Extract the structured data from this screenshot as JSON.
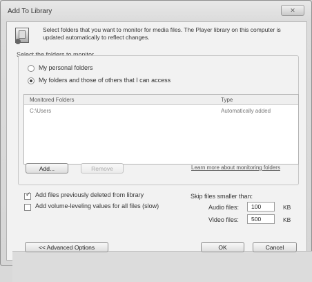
{
  "window": {
    "title": "Add To Library",
    "close_label": "✕"
  },
  "header": {
    "text": "Select folders that you want to monitor for media files. The Player library on this computer is updated automatically to reflect changes."
  },
  "folders_section": {
    "label": "Select the folders to monitor",
    "options": [
      {
        "label": "My personal folders",
        "selected": false
      },
      {
        "label": "My folders and those of others that I can access",
        "selected": true
      }
    ],
    "table": {
      "columns": [
        "Monitored Folders",
        "Type"
      ],
      "rows": [
        {
          "folder": "C:\\Users",
          "type": "Automatically added"
        }
      ]
    },
    "add_button": "Add...",
    "remove_button": "Remove",
    "learn_more_link": "Learn more about monitoring folders"
  },
  "options": {
    "add_deleted_label": "Add files previously deleted from library",
    "add_deleted_checked": true,
    "volume_leveling_label": "Add volume-leveling values for all files (slow)",
    "volume_leveling_checked": false
  },
  "skip_files": {
    "label": "Skip files smaller than:",
    "audio_label": "Audio files:",
    "audio_value": "100",
    "audio_unit": "KB",
    "video_label": "Video files:",
    "video_value": "500",
    "video_unit": "KB"
  },
  "footer": {
    "advanced_button": "<< Advanced Options",
    "ok_button": "OK",
    "cancel_button": "Cancel"
  }
}
